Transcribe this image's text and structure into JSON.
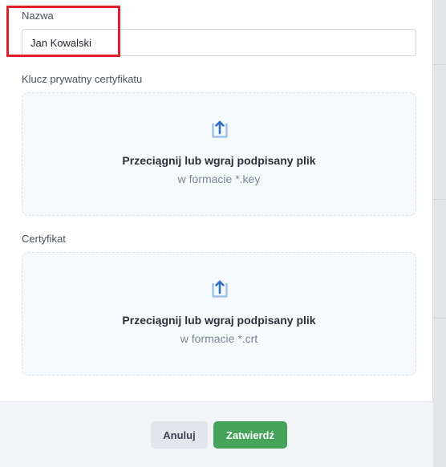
{
  "form": {
    "name_label": "Nazwa",
    "name_value": "Jan Kowalski",
    "key_label": "Klucz prywatny certyfikatu",
    "cert_label": "Certyfikat"
  },
  "dropzones": {
    "key": {
      "title": "Przeciągnij lub wgraj podpisany plik",
      "subtitle": "w formacie *.key",
      "icon": "upload-icon"
    },
    "cert": {
      "title": "Przeciągnij lub wgraj podpisany plik",
      "subtitle": "w formacie *.crt",
      "icon": "upload-icon"
    }
  },
  "footer": {
    "cancel_label": "Anuluj",
    "confirm_label": "Zatwierdź"
  },
  "colors": {
    "highlight": "#e0202a",
    "confirm": "#45a35a",
    "upload_icon": "#2f6fc4"
  }
}
